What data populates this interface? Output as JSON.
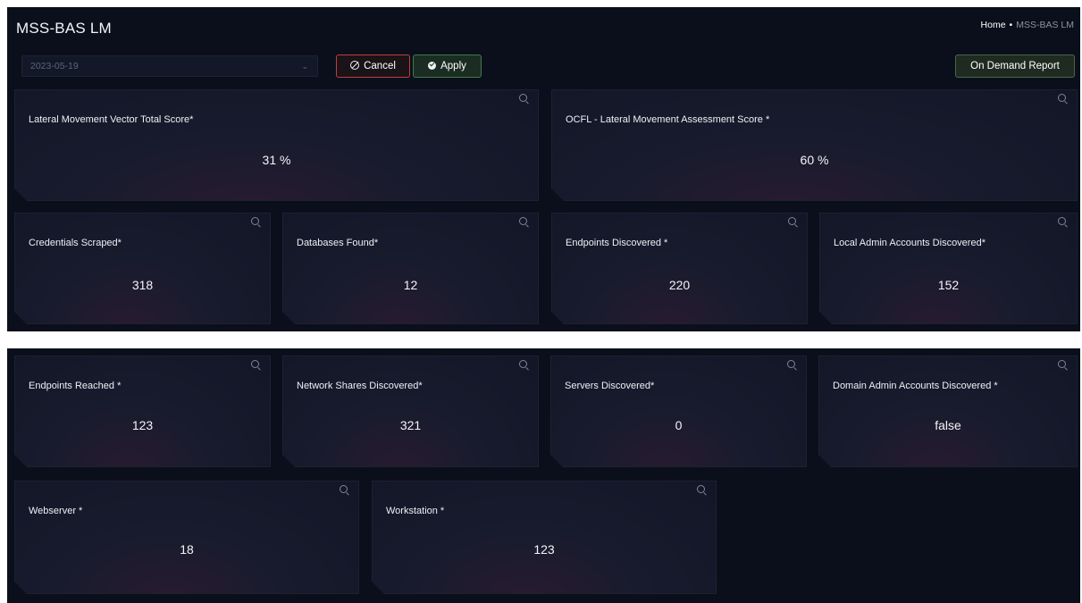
{
  "app_title": "MSS-BAS LM",
  "breadcrumb": {
    "home": "Home",
    "separator": "•",
    "current": "MSS-BAS LM"
  },
  "filters": {
    "date_value": "2023-05-19",
    "chevron_icon": "chevron-down-icon"
  },
  "buttons": {
    "cancel": "Cancel",
    "apply": "Apply",
    "report": "On Demand Report"
  },
  "colors": {
    "cancel_border": "#c43c3c",
    "apply_border": "#3f7a49",
    "report_border": "#47684a",
    "background": "#0a0f1b"
  },
  "cards": [
    {
      "title": "Lateral Movement Vector Total Score*",
      "value": "31 %"
    },
    {
      "title": "OCFL - Lateral Movement Assessment Score *",
      "value": "60 %"
    },
    {
      "title": "Credentials Scraped*",
      "value": "318"
    },
    {
      "title": "Databases Found*",
      "value": "12"
    },
    {
      "title": "Endpoints Discovered *",
      "value": "220"
    },
    {
      "title": "Local Admin Accounts Discovered*",
      "value": "152"
    },
    {
      "title": "Endpoints Reached *",
      "value": "123"
    },
    {
      "title": "Network Shares Discovered*",
      "value": "321"
    },
    {
      "title": "Servers Discovered*",
      "value": "0"
    },
    {
      "title": "Domain Admin Accounts Discovered *",
      "value": "false"
    },
    {
      "title": "Webserver *",
      "value": "18"
    },
    {
      "title": "Workstation *",
      "value": "123"
    }
  ]
}
